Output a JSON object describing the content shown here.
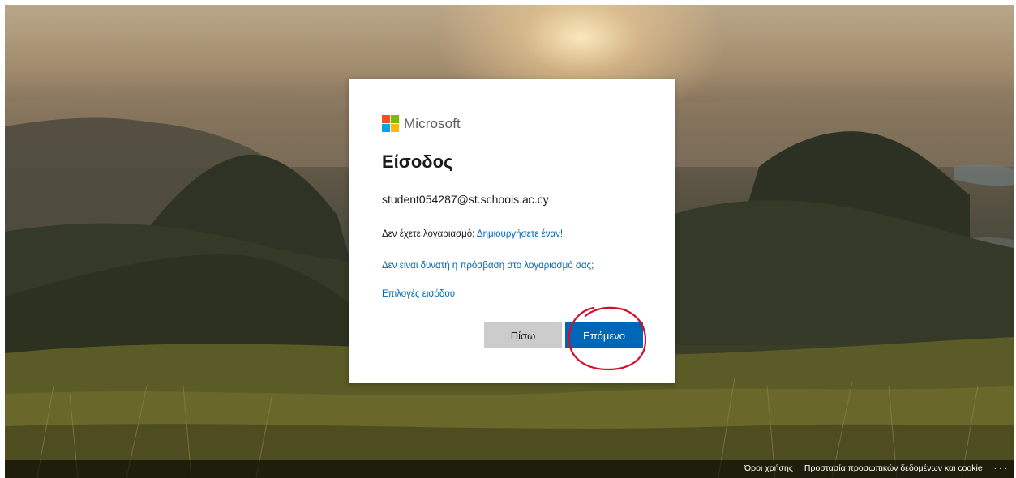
{
  "brand": {
    "name": "Microsoft",
    "logo_colors": [
      "#f25022",
      "#7fba00",
      "#00a4ef",
      "#ffb900"
    ]
  },
  "signin": {
    "title": "Είσοδος",
    "email_value": "student054287@st.schools.ac.cy",
    "no_account_text": "Δεν έχετε λογαριασμό;",
    "create_link": "Δημιουργήσετε έναν!",
    "cant_access_link": "Δεν είναι δυνατή η πρόσβαση στο λογαριασμό σας;",
    "signin_options_link": "Επιλογές εισόδου",
    "back_label": "Πίσω",
    "next_label": "Επόμενο"
  },
  "footer": {
    "terms": "Όροι χρήσης",
    "privacy": "Προστασία προσωπικών δεδομένων και cookie",
    "more": "· · ·"
  },
  "colors": {
    "accent": "#0067b8",
    "annotation": "#d0102a"
  }
}
